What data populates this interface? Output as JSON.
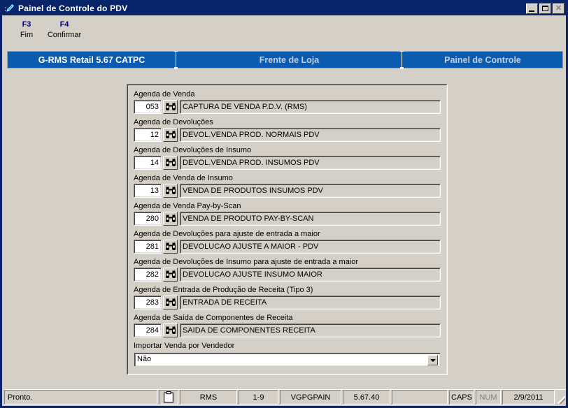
{
  "window": {
    "title": "Painel de Controle do PDV",
    "icon": "pen-app-icon",
    "controls": {
      "minimize": "minimize-icon",
      "maximize": "maximize-icon",
      "close": "close-icon"
    }
  },
  "function_keys": [
    {
      "key": "F3",
      "label": "Fim"
    },
    {
      "key": "F4",
      "label": "Confirmar"
    }
  ],
  "tabs": [
    {
      "label": "G-RMS Retail 5.67 CATPC",
      "active": true
    },
    {
      "label": "Frente de Loja",
      "active": false
    },
    {
      "label": "Painel de Controle",
      "active": false
    }
  ],
  "colors": {
    "titlebar": "#0a246a",
    "tab_bar": "#0b5bb0",
    "face": "#d4d0c8",
    "fn_key": "#000080"
  },
  "form": {
    "fields": [
      {
        "label": "Agenda de Venda",
        "code": "053",
        "description": "CAPTURA DE VENDA P.D.V. (RMS)",
        "lookup_icon": "binoculars-icon"
      },
      {
        "label": "Agenda de Devoluções",
        "code": "12",
        "description": "DEVOL.VENDA PROD. NORMAIS PDV",
        "lookup_icon": "binoculars-icon"
      },
      {
        "label": "Agenda de Devoluções de Insumo",
        "code": "14",
        "description": "DEVOL.VENDA PROD. INSUMOS PDV",
        "lookup_icon": "binoculars-icon"
      },
      {
        "label": "Agenda de Venda de Insumo",
        "code": "13",
        "description": "VENDA DE PRODUTOS INSUMOS PDV",
        "lookup_icon": "binoculars-icon"
      },
      {
        "label": "Agenda de Venda Pay-by-Scan",
        "code": "280",
        "description": "VENDA DE PRODUTO PAY-BY-SCAN",
        "lookup_icon": "binoculars-icon"
      },
      {
        "label": "Agenda de Devoluções para ajuste de entrada a maior",
        "code": "281",
        "description": "DEVOLUCAO AJUSTE A MAIOR - PDV",
        "lookup_icon": "binoculars-icon"
      },
      {
        "label": "Agenda de Devoluções de Insumo  para ajuste de entrada a maior",
        "code": "282",
        "description": "DEVOLUCAO AJUSTE INSUMO MAIOR",
        "lookup_icon": "binoculars-icon"
      },
      {
        "label": "Agenda de Entrada de Produção de Receita (Tipo 3)",
        "code": "283",
        "description": "ENTRADA DE RECEITA",
        "lookup_icon": "binoculars-icon"
      },
      {
        "label": "Agenda de Saída de Componentes de Receita",
        "code": "284",
        "description": "SAIDA DE COMPONENTES RECEITA",
        "lookup_icon": "binoculars-icon"
      }
    ],
    "combo": {
      "label": "Importar Venda por Vendedor",
      "value": "Não",
      "arrow_icon": "chevron-down-icon"
    }
  },
  "statusbar": {
    "message": "Pronto.",
    "clipboard_icon": "clipboard-icon",
    "system": "RMS",
    "range": "1-9",
    "program": "VGPGPAIN",
    "version": "5.67.40",
    "blank": "",
    "caps": "CAPS",
    "num": "NUM",
    "date": "2/9/2011"
  }
}
